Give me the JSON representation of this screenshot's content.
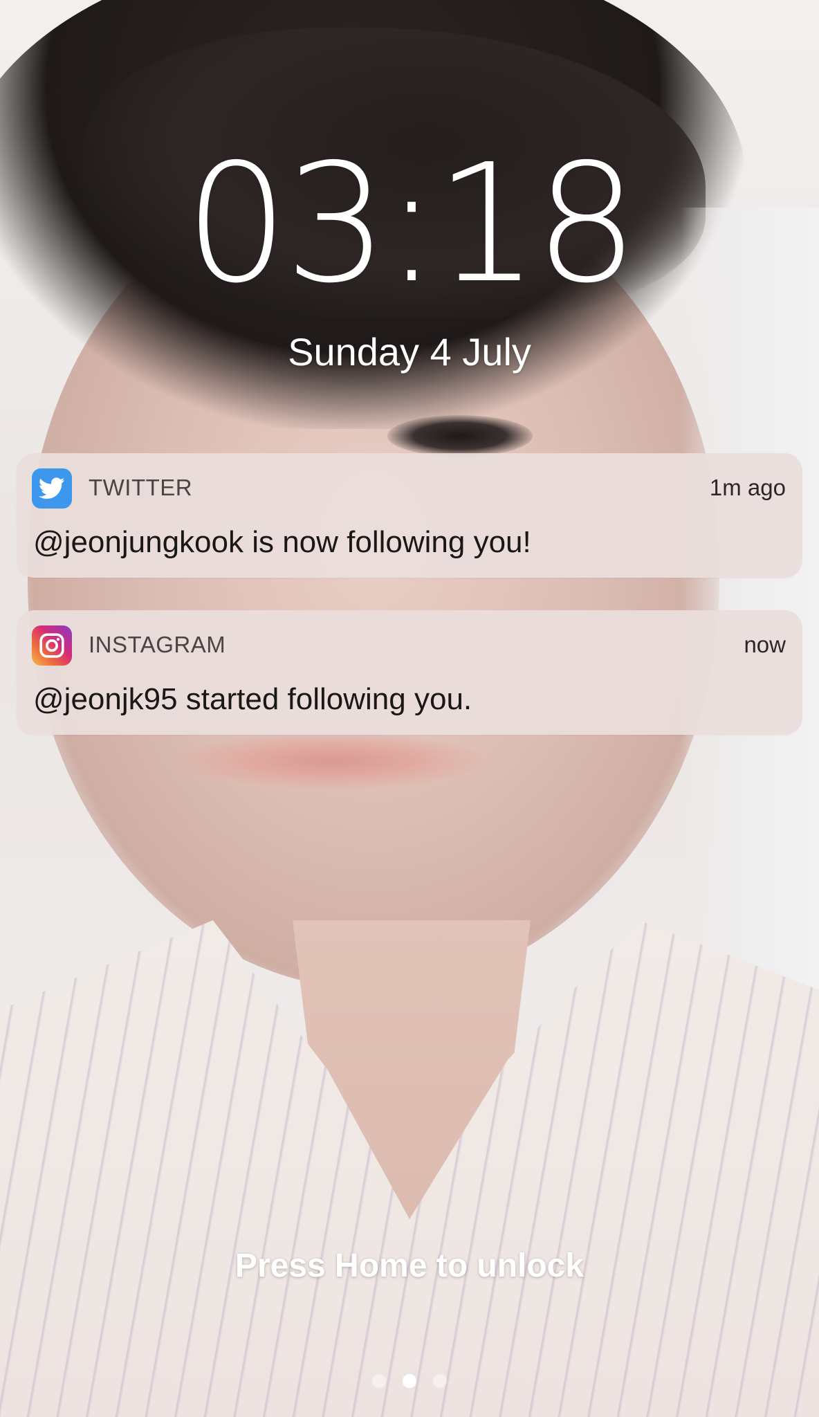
{
  "lockscreen": {
    "time": "03:18",
    "date": "Sunday 4 July",
    "unlock_hint": "Press Home to unlock",
    "page_count": 3,
    "active_page": 1
  },
  "notifications": [
    {
      "app": "TWITTER",
      "icon": "twitter-bird-icon",
      "time": "1m ago",
      "message": "@jeonjungkook is now following you!",
      "accent": "#3d97ec"
    },
    {
      "app": "INSTAGRAM",
      "icon": "instagram-camera-icon",
      "time": "now",
      "message": "@jeonjk95 started following you.",
      "accent": "#d42b78"
    }
  ]
}
